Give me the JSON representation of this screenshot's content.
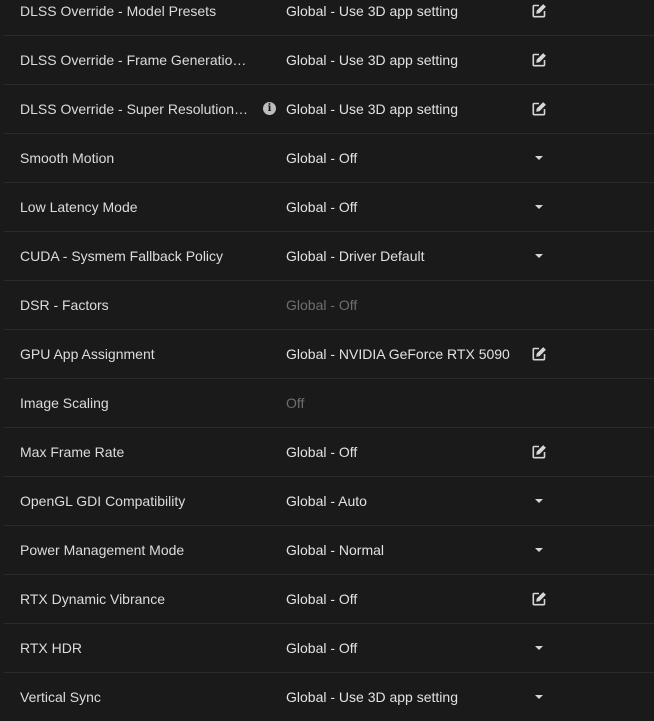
{
  "settings": [
    {
      "name": "DLSS Override - Model Presets",
      "value": "Global - Use 3D app setting",
      "control": "edit-icon",
      "info": false,
      "disabled": false
    },
    {
      "name": "DLSS Override - Frame Generatio…",
      "value": "Global - Use 3D app setting",
      "control": "edit-icon",
      "info": false,
      "disabled": false
    },
    {
      "name": "DLSS Override - Super Resolution …",
      "value": "Global - Use 3D app setting",
      "control": "edit-icon",
      "info": true,
      "disabled": false
    },
    {
      "name": "Smooth Motion",
      "value": "Global - Off",
      "control": "chevron-down-icon",
      "info": false,
      "disabled": false
    },
    {
      "name": "Low Latency Mode",
      "value": "Global - Off",
      "control": "chevron-down-icon",
      "info": false,
      "disabled": false
    },
    {
      "name": "CUDA - Sysmem Fallback Policy",
      "value": "Global - Driver Default",
      "control": "chevron-down-icon",
      "info": false,
      "disabled": false
    },
    {
      "name": "DSR - Factors",
      "value": "Global - Off",
      "control": "none",
      "info": false,
      "disabled": true
    },
    {
      "name": "GPU App Assignment",
      "value": "Global - NVIDIA GeForce RTX 5090",
      "control": "edit-icon",
      "info": false,
      "disabled": false
    },
    {
      "name": "Image Scaling",
      "value": "Off",
      "control": "none",
      "info": false,
      "disabled": true
    },
    {
      "name": "Max Frame Rate",
      "value": "Global - Off",
      "control": "edit-icon",
      "info": false,
      "disabled": false
    },
    {
      "name": "OpenGL GDI Compatibility",
      "value": "Global - Auto",
      "control": "chevron-down-icon",
      "info": false,
      "disabled": false
    },
    {
      "name": "Power Management Mode",
      "value": "Global - Normal",
      "control": "chevron-down-icon",
      "info": false,
      "disabled": false
    },
    {
      "name": "RTX Dynamic Vibrance",
      "value": "Global - Off",
      "control": "edit-icon",
      "info": false,
      "disabled": false
    },
    {
      "name": "RTX HDR",
      "value": "Global - Off",
      "control": "chevron-down-icon",
      "info": false,
      "disabled": false
    },
    {
      "name": "Vertical Sync",
      "value": "Global - Use 3D app setting",
      "control": "chevron-down-icon",
      "info": false,
      "disabled": false
    }
  ],
  "info_icon_glyph": "i",
  "colors": {
    "background": "#1a1a1a",
    "divider": "#2a2a2a",
    "text": "#e2e2e2",
    "disabled_text": "#6e6e6e",
    "icon": "#d6d6d6"
  }
}
